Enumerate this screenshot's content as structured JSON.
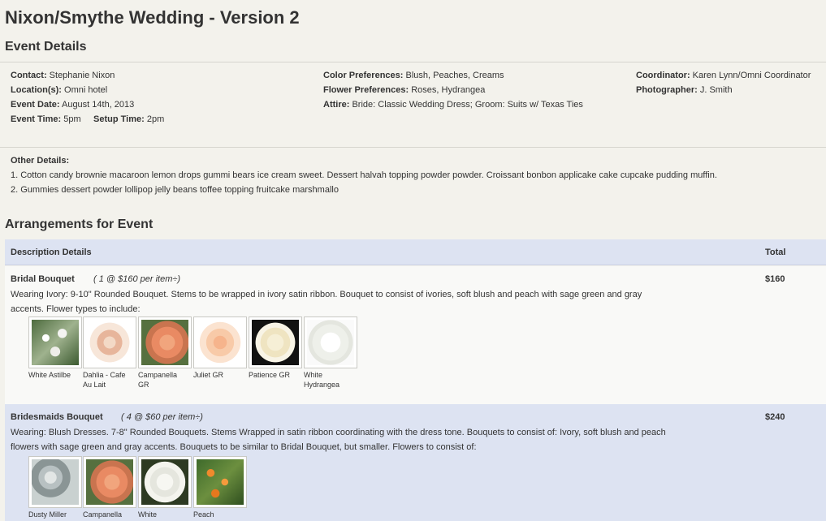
{
  "page": {
    "title": "Nixon/Smythe Wedding - Version 2"
  },
  "event_details": {
    "heading": "Event Details",
    "contact_label": "Contact:",
    "contact": "Stephanie Nixon",
    "location_label": "Location(s):",
    "location": "Omni hotel",
    "event_date_label": "Event Date:",
    "event_date": "August 14th, 2013",
    "event_time_label": "Event Time:",
    "event_time": "5pm",
    "setup_time_label": "Setup Time:",
    "setup_time": "2pm",
    "color_label": "Color Preferences:",
    "color": "Blush, Peaches, Creams",
    "flower_label": "Flower Preferences:",
    "flower": "Roses, Hydrangea",
    "attire_label": "Attire:",
    "attire": "Bride: Classic Wedding Dress; Groom: Suits w/ Texas Ties",
    "coordinator_label": "Coordinator:",
    "coordinator": "Karen Lynn/Omni Coordinator",
    "photographer_label": "Photographer:",
    "photographer": "J. Smith"
  },
  "other_details": {
    "label": "Other Details:",
    "lines": [
      "1. Cotton candy brownie macaroon lemon drops gummi bears ice cream sweet. Dessert halvah topping powder powder. Croissant bonbon applicake cake cupcake pudding muffin.",
      "2. Gummies dessert powder lollipop jelly beans toffee topping fruitcake marshmallo"
    ]
  },
  "arrangements": {
    "heading": "Arrangements for Event",
    "col_description": "Description Details",
    "col_total": "Total",
    "items": [
      {
        "name": "Bridal Bouquet",
        "qty": "( 1 @ $160 per item÷)",
        "total": "$160",
        "desc1": "Wearing Ivory: 9-10\" Rounded Bouquet. Stems to be wrapped in ivory satin ribbon. Bouquet to consist of ivories, soft blush and peach with sage green and gray",
        "desc2": "accents. Flower types to include:",
        "flowers": [
          "White Astilbe",
          "Dahlia - Cafe Au Lait",
          "Campanella GR",
          "Juliet GR",
          "Patience GR",
          "White Hydrangea"
        ]
      },
      {
        "name": "Bridesmaids Bouquet",
        "qty": "( 4 @ $60 per item÷)",
        "total": "$240",
        "desc1": "Wearing: Blush Dresses. 7-8\" Rounded Bouquets. Stems Wrapped in satin ribbon coordinating with the dress tone. Bouquets to consist of: Ivory, soft blush and peach",
        "desc2": "flowers with sage green and gray accents. Bouquets to be similar to Bridal Bouquet, but smaller. Flowers to consist of:",
        "flowers": [
          "Dusty Miller",
          "Campanella",
          "White",
          "Peach"
        ]
      }
    ]
  }
}
